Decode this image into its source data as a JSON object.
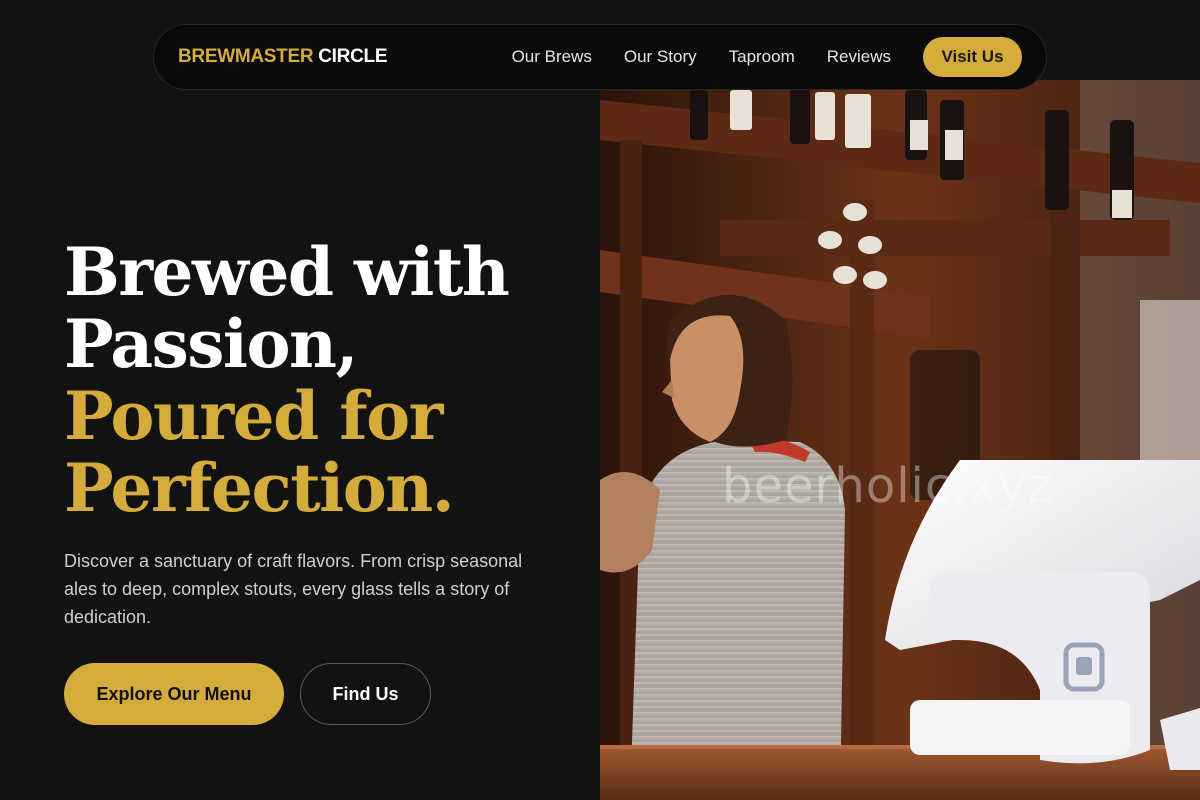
{
  "brand": {
    "part1": "BREWMASTER",
    "part2": "CIRCLE"
  },
  "nav": {
    "links": [
      "Our Brews",
      "Our Story",
      "Taproom",
      "Reviews"
    ],
    "cta": "Visit Us"
  },
  "hero": {
    "headline_white": [
      "Brewed with",
      "Passion,"
    ],
    "headline_gold": [
      "Poured for",
      "Perfection."
    ],
    "lead": "Discover a sanctuary of craft flavors. From crisp seasonal ales to deep, complex stouts, every glass tells a story of dedication.",
    "primary_cta": "Explore Our Menu",
    "secondary_cta": "Find Us"
  },
  "image": {
    "watermark": "beerholic.xyz"
  },
  "colors": {
    "accent": "#d4ac3b",
    "background": "#121212",
    "nav_bg": "#0a0a0a"
  }
}
